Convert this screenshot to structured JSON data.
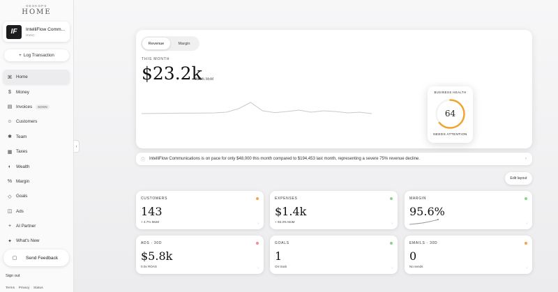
{
  "brand": {
    "top": "DESKOPS",
    "name": "HOME"
  },
  "org": {
    "name": "IntelliFlow Comm...",
    "type": "HVAC",
    "logo_text": "IF"
  },
  "log_button": {
    "icon": "plus-icon",
    "label": "Log Transaction"
  },
  "nav": [
    {
      "label": "Home",
      "icon": "home-icon",
      "glyph": "⌘",
      "active": true
    },
    {
      "label": "Money",
      "icon": "dollar-icon",
      "glyph": "$"
    },
    {
      "label": "Invoices",
      "icon": "invoice-icon",
      "glyph": "▤",
      "badge": "SOON"
    },
    {
      "label": "Customers",
      "icon": "customers-icon",
      "glyph": "☺"
    },
    {
      "label": "Team",
      "icon": "team-icon",
      "glyph": "✱"
    },
    {
      "label": "Taxes",
      "icon": "taxes-icon",
      "glyph": "▦"
    },
    {
      "label": "Wealth",
      "icon": "wealth-icon",
      "glyph": "◐"
    },
    {
      "label": "Margin",
      "icon": "percent-icon",
      "glyph": "%"
    },
    {
      "label": "Goals",
      "icon": "goals-icon",
      "glyph": "◇"
    },
    {
      "label": "Ads",
      "icon": "ads-icon",
      "glyph": "◫"
    },
    {
      "label": "AI Partner",
      "icon": "ai-icon",
      "glyph": "+"
    },
    {
      "label": "What's New",
      "icon": "sparkle-icon",
      "glyph": "✦"
    }
  ],
  "feedback": {
    "label": "Send Feedback",
    "icon": "chat-icon"
  },
  "signout": "Sign out",
  "footer": {
    "terms": "Terms",
    "privacy": "Privacy",
    "status": "Status",
    "sep": "·"
  },
  "hero": {
    "tabs": [
      "Revenue",
      "Margin"
    ],
    "active_tab": "Revenue",
    "period": "THIS MONTH",
    "value": "$23.2k",
    "delta": "+ 88.1% MoM",
    "trend": [
      0.15,
      0.16,
      0.17,
      0.18,
      0.18,
      0.19,
      0.2,
      0.25,
      0.5,
      0.95,
      0.35,
      0.22,
      0.3,
      0.4,
      0.25,
      0.35,
      0.3,
      0.2,
      0.25,
      0.15
    ]
  },
  "health": {
    "title": "BUSINESS HEALTH",
    "score": "64",
    "score_fraction": 0.64,
    "status": "NEEDS ATTENTION",
    "color": "#f1a52e"
  },
  "banner": {
    "text": "IntelliFlow Communications is on pace for only $48,000 this month compared to $194,453 last month, representing a severe 75% revenue decline."
  },
  "edit_layout": "Edit layout",
  "cards": [
    {
      "title": "CUSTOMERS",
      "value": "143",
      "sub": "+ 4.7% MoM",
      "dot": "#f0a64a"
    },
    {
      "title": "EXPENSES",
      "value": "$1.4k",
      "sub": "+ 93.3% MoM",
      "dot": "#8fd18a"
    },
    {
      "title": "MARGIN",
      "value": "95.6%",
      "sub": "",
      "dot": "#8fd18a"
    },
    {
      "title": "ADS · 30D",
      "value": "$5.8k",
      "sub": "0.0x ROAS",
      "dot": "#f28b9b"
    },
    {
      "title": "GOALS",
      "value": "1",
      "sub": "On track",
      "dot": "#8fd18a"
    },
    {
      "title": "EMAILS · 30D",
      "value": "0",
      "sub": "No sends",
      "dot": "#f0a64a"
    }
  ]
}
